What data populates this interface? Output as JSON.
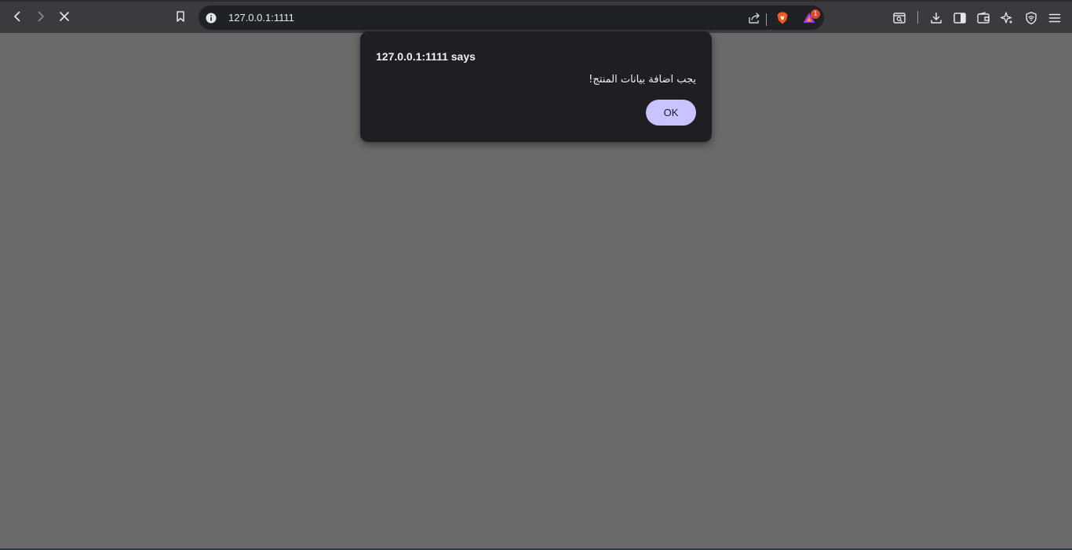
{
  "browser": {
    "url": "127.0.0.1:1111",
    "notification_count": "1",
    "icons": {
      "back": "back-arrow-icon",
      "forward": "forward-arrow-icon",
      "stop": "stop-loading-icon",
      "bookmark": "bookmark-icon",
      "site_info": "site-info-icon",
      "share": "share-icon",
      "brave_shields": "brave-shields-icon",
      "brave_rewards": "brave-rewards-icon",
      "search_tabs": "tab-search-icon",
      "downloads": "download-icon",
      "sidebar": "sidebar-icon",
      "wallet": "wallet-icon",
      "leo": "leo-ai-icon",
      "vpn": "vpn-shield-icon",
      "menu": "hamburger-menu-icon"
    }
  },
  "dialog": {
    "title": "127.0.0.1:1111 says",
    "message": "يجب اضافة بيانات المنتج!",
    "ok_label": "OK"
  },
  "colors": {
    "page_background": "#6a6a6a",
    "toolbar": "#3b3b3e",
    "omnibox": "#202124",
    "dialog_background": "#1f1e22",
    "ok_button": "#c8c4ff",
    "badge": "#e0462f"
  }
}
